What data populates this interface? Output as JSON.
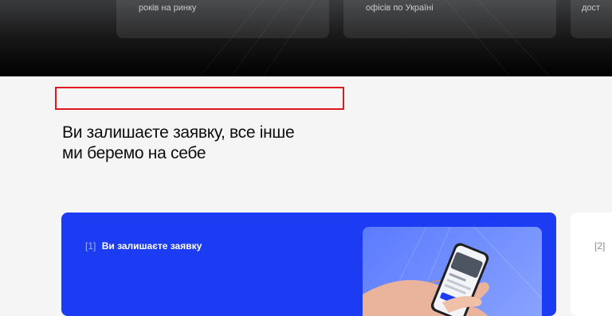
{
  "stats": [
    {
      "label": "років на ринку"
    },
    {
      "label": "офісів по Україні"
    },
    {
      "label": "дост"
    }
  ],
  "section": {
    "title_line1": "Ви залишаєте заявку, все інше",
    "title_line2": "ми беремо на себе"
  },
  "steps": [
    {
      "number": "[1]",
      "title": "Ви залишаєте заявку"
    },
    {
      "number": "[2]"
    }
  ],
  "colors": {
    "accent_blue": "#1b3cf3",
    "highlight_red": "#e0181f",
    "hero_dark": "#000000"
  }
}
